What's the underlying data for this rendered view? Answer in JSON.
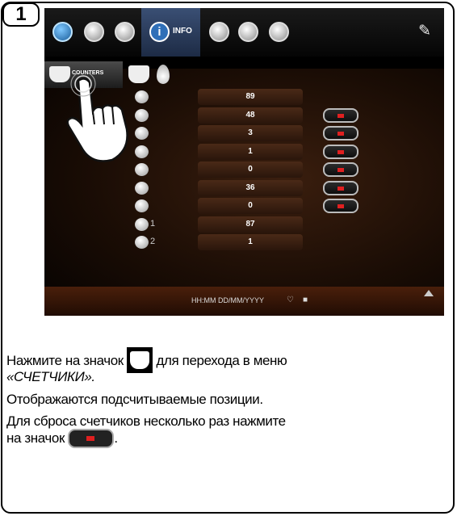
{
  "step": {
    "number": "1"
  },
  "device": {
    "info_tab_label": "INFO",
    "tabs": [
      {
        "icon": "drop-icon"
      },
      {
        "icon": "clock-icon"
      },
      {
        "icon": "cup-icon"
      },
      {
        "icon": "info-icon"
      },
      {
        "icon": "pencil-icon"
      },
      {
        "icon": "calendar-icon"
      },
      {
        "icon": "user-icon"
      },
      {
        "icon": "wrench-icon"
      }
    ],
    "counters_tab_label": "COUNTERS",
    "counters": [
      {
        "icon": "sum-icon",
        "suffix": "",
        "value": "89",
        "reset": false
      },
      {
        "icon": "coffee-bean-icon",
        "suffix": "",
        "value": "48",
        "reset": true
      },
      {
        "icon": "milk-bottle-icon",
        "suffix": "",
        "value": "3",
        "reset": true
      },
      {
        "icon": "powder-bottle-icon",
        "suffix": "",
        "value": "1",
        "reset": true
      },
      {
        "icon": "tablet-icon",
        "suffix": "",
        "value": "0",
        "reset": true
      },
      {
        "icon": "water-drop-icon",
        "suffix": "",
        "value": "36",
        "reset": true
      },
      {
        "icon": "steam-icon",
        "suffix": "",
        "value": "0",
        "reset": true
      },
      {
        "icon": "grinder-icon",
        "suffix": "1",
        "value": "87",
        "reset": false
      },
      {
        "icon": "grinder-icon",
        "suffix": "2",
        "value": "1",
        "reset": false
      }
    ],
    "status_text": "HH:MM DD/MM/YYYY"
  },
  "instructions": {
    "line1_before": "Нажмите на значок",
    "line1_after": "для перехода в меню",
    "line2": "«СЧЕТЧИКИ».",
    "line3": "Отображаются подсчитываемые позиции.",
    "line4": "Для сброса счетчиков несколько раз нажмите",
    "line5": "на значок",
    "line5_end": "."
  }
}
